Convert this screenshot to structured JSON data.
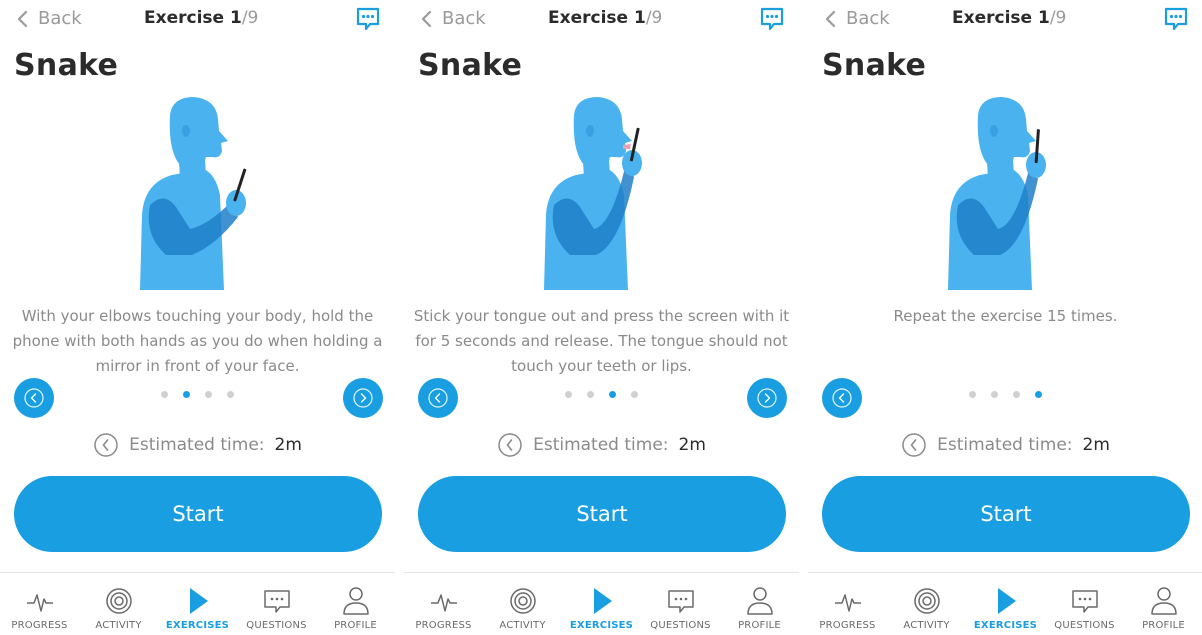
{
  "screens": [
    {
      "back_label": "Back",
      "title_prefix": "Exercise ",
      "title_index": "1",
      "title_total": "/9",
      "heading": "Snake",
      "description": "With your elbows touching your body, hold the phone with both hands as you do when holding a mirror in front of your face.",
      "dots": 4,
      "active_dot": 1,
      "has_prev": true,
      "has_next": true,
      "pose": "hold-phone-low",
      "est_label": "Estimated time:",
      "est_value": "2m",
      "start_label": "Start"
    },
    {
      "back_label": "Back",
      "title_prefix": "Exercise ",
      "title_index": "1",
      "title_total": "/9",
      "heading": "Snake",
      "description": "Stick your tongue out and press the screen with it for 5 seconds and release. The tongue should not touch your teeth or lips.",
      "dots": 4,
      "active_dot": 2,
      "has_prev": true,
      "has_next": true,
      "pose": "tongue-press",
      "est_label": "Estimated time:",
      "est_value": "2m",
      "start_label": "Start"
    },
    {
      "back_label": "Back",
      "title_prefix": "Exercise ",
      "title_index": "1",
      "title_total": "/9",
      "heading": "Snake",
      "description": "Repeat the exercise 15 times.",
      "dots": 4,
      "active_dot": 3,
      "has_prev": true,
      "has_next": false,
      "pose": "hold-phone-high",
      "est_label": "Estimated time:",
      "est_value": "2m",
      "start_label": "Start"
    }
  ],
  "tabs": [
    {
      "label": "PROGRESS",
      "icon": "pulse-icon",
      "active": false
    },
    {
      "label": "ACTIVITY",
      "icon": "activity-rings-icon",
      "active": false
    },
    {
      "label": "EXERCISES",
      "icon": "play-icon",
      "active": true
    },
    {
      "label": "QUESTIONS",
      "icon": "chat-icon",
      "active": false
    },
    {
      "label": "PROFILE",
      "icon": "person-icon",
      "active": false
    }
  ],
  "colors": {
    "accent": "#1a9ee2",
    "figure_light": "#4ab3ef",
    "figure_dark": "#1e7fc8",
    "text_muted": "#8a8a8a",
    "text_dark": "#2b2b2b"
  }
}
